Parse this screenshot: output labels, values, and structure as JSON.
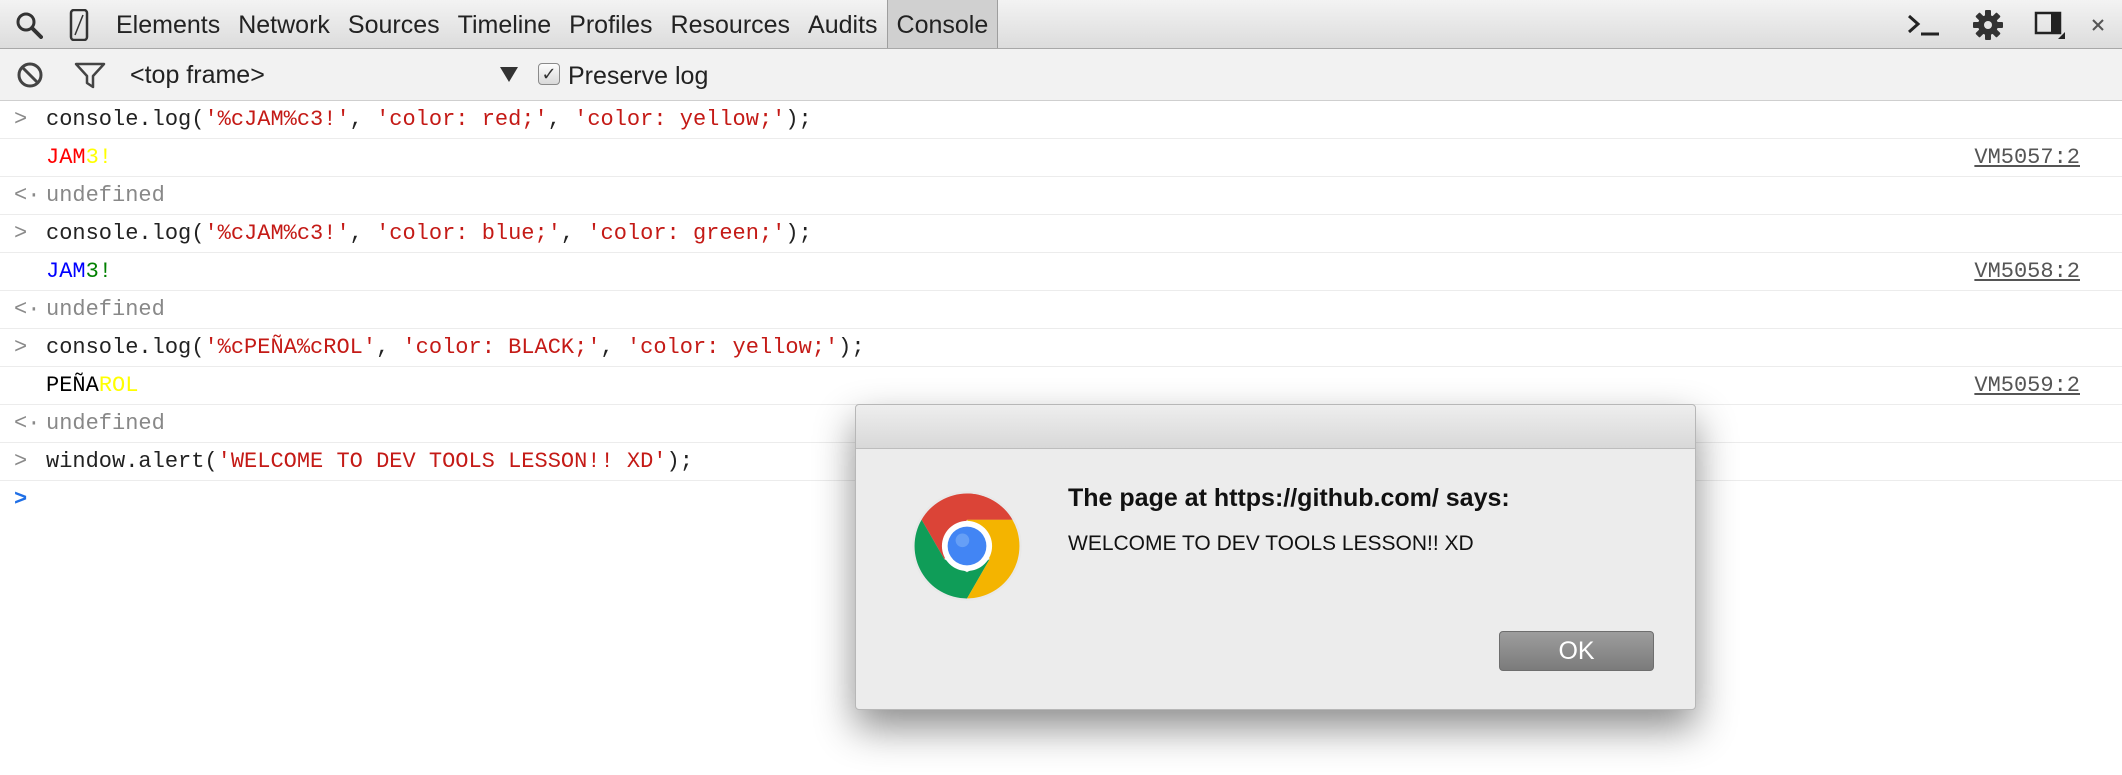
{
  "tabbar": {
    "tabs": [
      "Elements",
      "Network",
      "Sources",
      "Timeline",
      "Profiles",
      "Resources",
      "Audits",
      "Console"
    ],
    "selected": "Console"
  },
  "toolbar": {
    "frame": "<top frame>",
    "preserve_log_label": "Preserve log",
    "preserve_log_checked": true
  },
  "console": {
    "rows": [
      {
        "type": "input",
        "segments": [
          {
            "text": "console.log(",
            "style": "code"
          },
          {
            "text": "'%cJAM%c3!'",
            "style": "string"
          },
          {
            "text": ", ",
            "style": "code"
          },
          {
            "text": "'color: red;'",
            "style": "string"
          },
          {
            "text": ", ",
            "style": "code"
          },
          {
            "text": "'color: yellow;'",
            "style": "string"
          },
          {
            "text": ");",
            "style": "code"
          }
        ]
      },
      {
        "type": "log",
        "segments": [
          {
            "text": "JAM",
            "color": "#ff0000"
          },
          {
            "text": "3!",
            "color": "#ffff00"
          }
        ],
        "source": "VM5057:2"
      },
      {
        "type": "result",
        "segments": [
          {
            "text": "undefined",
            "style": "undef"
          }
        ]
      },
      {
        "type": "input",
        "segments": [
          {
            "text": "console.log(",
            "style": "code"
          },
          {
            "text": "'%cJAM%c3!'",
            "style": "string"
          },
          {
            "text": ", ",
            "style": "code"
          },
          {
            "text": "'color: blue;'",
            "style": "string"
          },
          {
            "text": ", ",
            "style": "code"
          },
          {
            "text": "'color: green;'",
            "style": "string"
          },
          {
            "text": ");",
            "style": "code"
          }
        ]
      },
      {
        "type": "log",
        "segments": [
          {
            "text": "JAM",
            "color": "#0000ff"
          },
          {
            "text": "3!",
            "color": "#008000"
          }
        ],
        "source": "VM5058:2"
      },
      {
        "type": "result",
        "segments": [
          {
            "text": "undefined",
            "style": "undef"
          }
        ]
      },
      {
        "type": "input",
        "segments": [
          {
            "text": "console.log(",
            "style": "code"
          },
          {
            "text": "'%cPEÑA%cROL'",
            "style": "string"
          },
          {
            "text": ", ",
            "style": "code"
          },
          {
            "text": "'color: BLACK;'",
            "style": "string"
          },
          {
            "text": ", ",
            "style": "code"
          },
          {
            "text": "'color: yellow;'",
            "style": "string"
          },
          {
            "text": ");",
            "style": "code"
          }
        ]
      },
      {
        "type": "log",
        "segments": [
          {
            "text": "PEÑA",
            "color": "#000000"
          },
          {
            "text": "ROL",
            "color": "#ffff00"
          }
        ],
        "source": "VM5059:2"
      },
      {
        "type": "result",
        "segments": [
          {
            "text": "undefined",
            "style": "undef"
          }
        ]
      },
      {
        "type": "input",
        "segments": [
          {
            "text": "window.alert(",
            "style": "code"
          },
          {
            "text": "'WELCOME TO DEV TOOLS LESSON!! XD'",
            "style": "string"
          },
          {
            "text": ");",
            "style": "code"
          }
        ]
      }
    ],
    "gutter_symbols": {
      "input": ">",
      "result": "<·",
      "prompt": ">"
    }
  },
  "dialog": {
    "title": "The page at https://github.com/ says:",
    "message": "WELCOME TO DEV TOOLS LESSON!! XD",
    "ok_label": "OK"
  },
  "icons": {
    "search": "search-icon",
    "device": "device-mode-icon",
    "clear": "clear-console-icon",
    "filter": "filter-icon",
    "drawer": "console-drawer-icon",
    "settings": "gear-icon",
    "dock": "dock-side-icon",
    "close": "close-icon",
    "logo": "chrome-logo-icon"
  },
  "colors": {
    "string": "#c41a16",
    "prompt": "#1f6fe6",
    "tab_selected_bg": "#d0d0d0"
  }
}
